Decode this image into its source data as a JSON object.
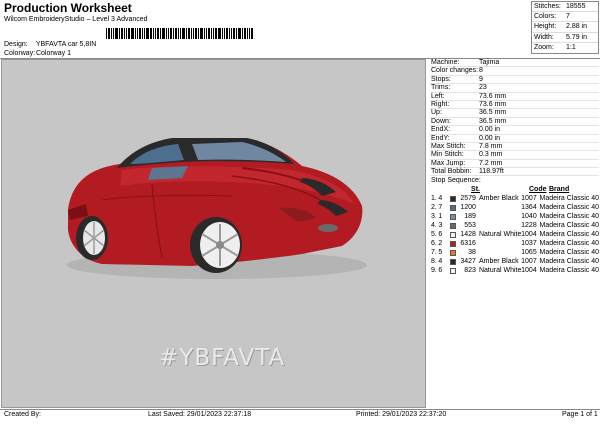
{
  "header": {
    "title": "Production Worksheet",
    "subtitle": "Wilcom EmbroideryStudio – Level 3 Advanced",
    "design_label": "Design:",
    "design_value": "YBFAVTA car 5,8IN",
    "colorway_label": "Colorway:",
    "colorway_value": "Colorway 1"
  },
  "stats": [
    {
      "label": "Stitches:",
      "value": "18555"
    },
    {
      "label": "Colors:",
      "value": "7"
    },
    {
      "label": "Height:",
      "value": "2.88 in"
    },
    {
      "label": "Width:",
      "value": "5.79 in"
    },
    {
      "label": "Zoom:",
      "value": "1:1"
    }
  ],
  "design_text": "#YBFAVTA",
  "machine_info": [
    {
      "label": "Machine:",
      "value": "Tajima"
    },
    {
      "label": "Color changes:",
      "value": "8"
    },
    {
      "label": "Stops:",
      "value": "9"
    },
    {
      "label": "Trims:",
      "value": "23"
    },
    {
      "label": "Left:",
      "value": "73.6 mm"
    },
    {
      "label": "Right:",
      "value": "73.6 mm"
    },
    {
      "label": "Up:",
      "value": "36.5 mm"
    },
    {
      "label": "Down:",
      "value": "36.5 mm"
    },
    {
      "label": "EndX:",
      "value": "0.00 in"
    },
    {
      "label": "EndY:",
      "value": "0.00 in"
    },
    {
      "label": "Max Stitch:",
      "value": "7.8 mm"
    },
    {
      "label": "Min Stitch:",
      "value": "0.3 mm"
    },
    {
      "label": "Max Jump:",
      "value": "7.2 mm"
    },
    {
      "label": "Total Bobbin:",
      "value": "118.97ft"
    }
  ],
  "stop_sequence": {
    "title": "Stop Sequence:",
    "headers": {
      "stitches": "St.",
      "code": "Code",
      "brand": "Brand"
    },
    "rows": [
      {
        "index": "1.",
        "needle": "4",
        "color": "#2a2a2a",
        "stitches": "2579",
        "name": "Amber Black",
        "code": "1007",
        "brand": "Madeira Classic 40"
      },
      {
        "index": "2.",
        "needle": "7",
        "color": "#4f6f8c",
        "stitches": "1200",
        "name": "",
        "code": "1364",
        "brand": "Madeira Classic 40"
      },
      {
        "index": "3.",
        "needle": "1",
        "color": "#7d8fa4",
        "stitches": "189",
        "name": "",
        "code": "1040",
        "brand": "Madeira Classic 40"
      },
      {
        "index": "4.",
        "needle": "3",
        "color": "#6a6a6a",
        "stitches": "553",
        "name": "",
        "code": "1228",
        "brand": "Madeira Classic 40"
      },
      {
        "index": "5.",
        "needle": "6",
        "color": "#f2f2f2",
        "stitches": "1428",
        "name": "Natural White",
        "code": "1004",
        "brand": "Madeira Classic 40"
      },
      {
        "index": "6.",
        "needle": "2",
        "color": "#b81c22",
        "stitches": "6316",
        "name": "",
        "code": "1037",
        "brand": "Madeira Classic 40"
      },
      {
        "index": "7.",
        "needle": "5",
        "color": "#e8772a",
        "stitches": "38",
        "name": "",
        "code": "1065",
        "brand": "Madeira Classic 40"
      },
      {
        "index": "8.",
        "needle": "4",
        "color": "#2a2a2a",
        "stitches": "3427",
        "name": "Amber Black",
        "code": "1007",
        "brand": "Madeira Classic 40"
      },
      {
        "index": "9.",
        "needle": "6",
        "color": "#f2f2f2",
        "stitches": "823",
        "name": "Natural White",
        "code": "1004",
        "brand": "Madeira Classic 40"
      }
    ]
  },
  "footer": {
    "created_by": "Created By:",
    "last_saved": "Last Saved: 29/01/2023 22:37:18",
    "printed": "Printed: 29/01/2023 22:37:20",
    "page": "Page 1 of 1"
  }
}
